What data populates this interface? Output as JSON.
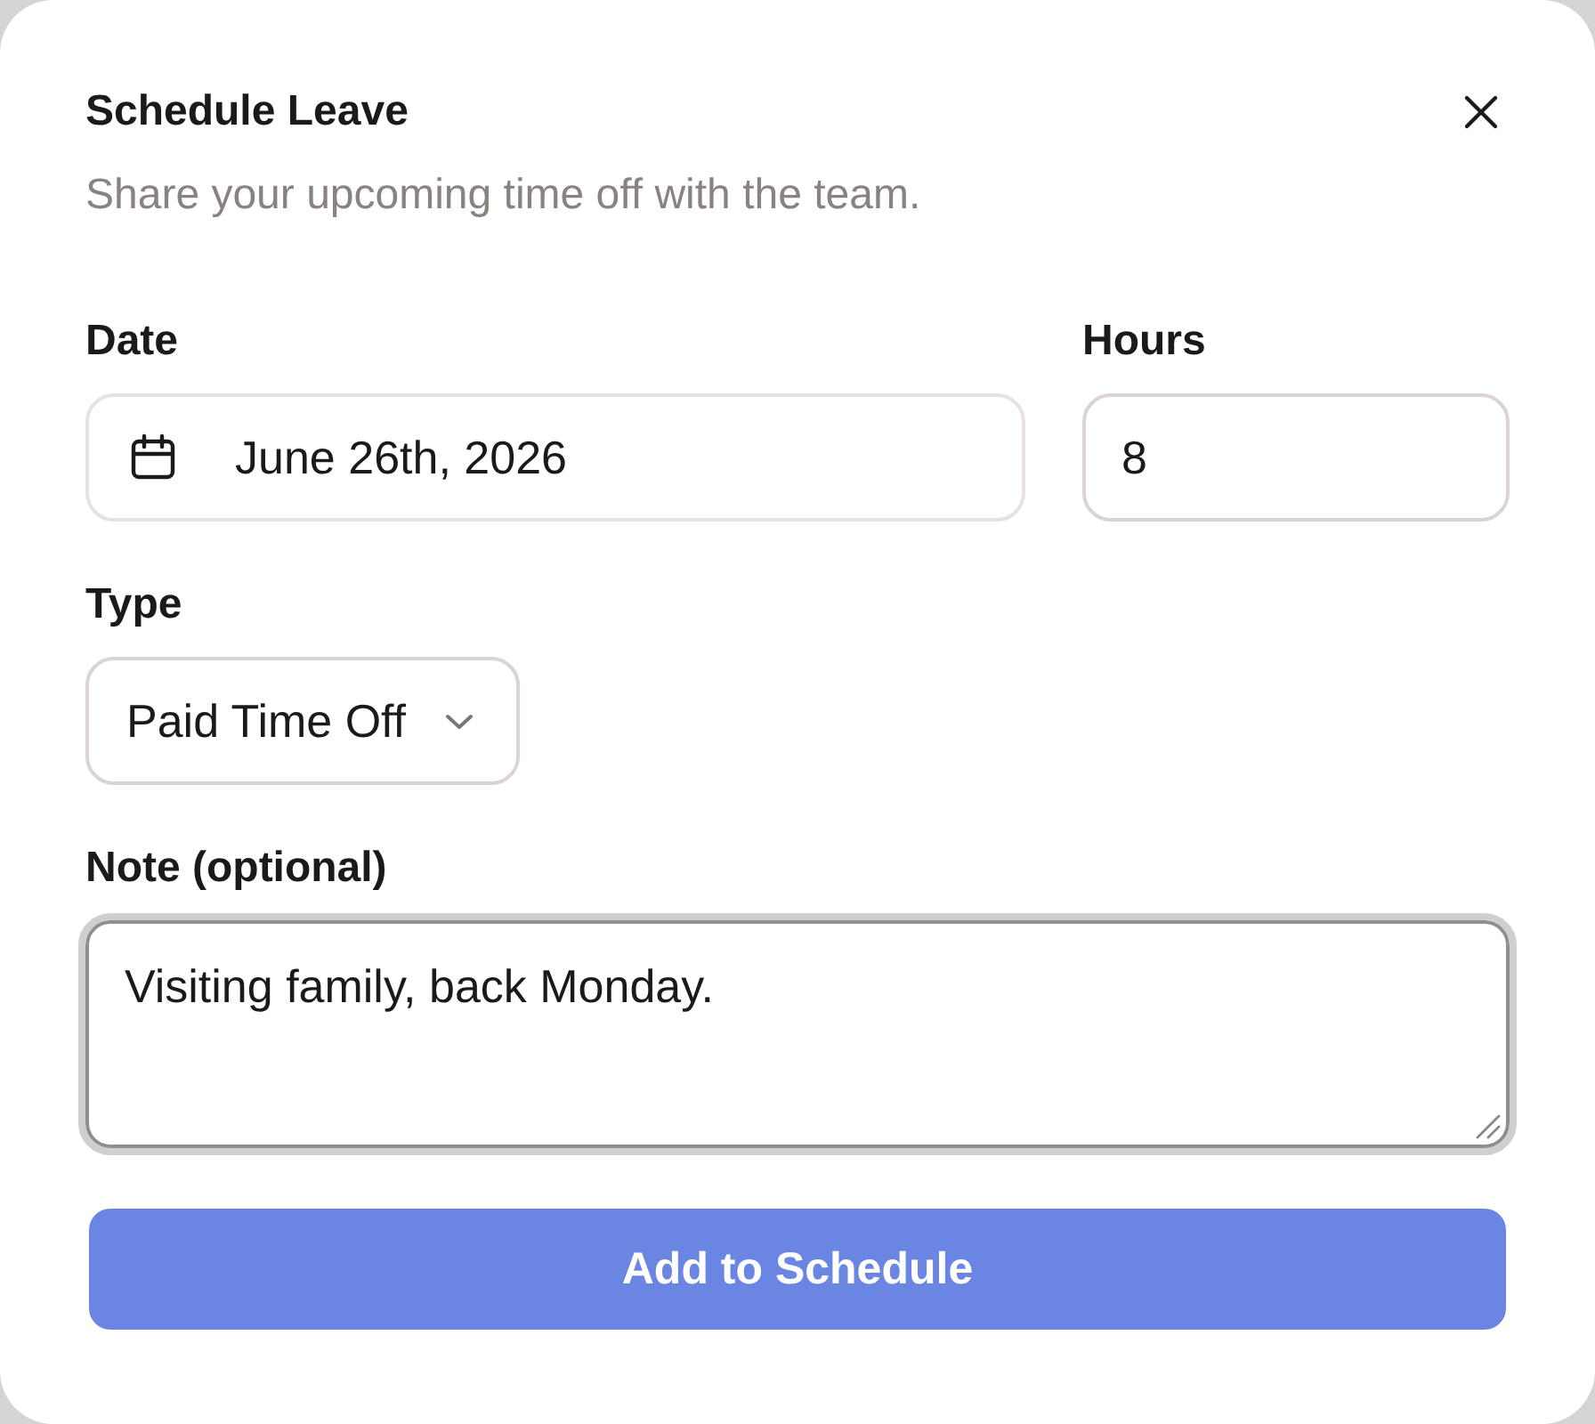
{
  "dialog": {
    "title": "Schedule Leave",
    "subtitle": "Share your upcoming time off with the team."
  },
  "rows": [
    {
      "fields": [
        {
          "kind": "date",
          "label": "Date",
          "value": "June 26th, 2026",
          "focused": false
        },
        {
          "kind": "number",
          "label": "Hours",
          "value": "8",
          "focused": false
        }
      ]
    },
    {
      "fields": [
        {
          "kind": "select",
          "label": "Type",
          "value": "Paid Time Off",
          "focused": false
        }
      ]
    },
    {
      "fields": [
        {
          "kind": "textarea",
          "label": "Note (optional)",
          "value": "Visiting family, back Monday.",
          "focused": true
        }
      ]
    }
  ],
  "submit": {
    "label": "Add to Schedule"
  }
}
